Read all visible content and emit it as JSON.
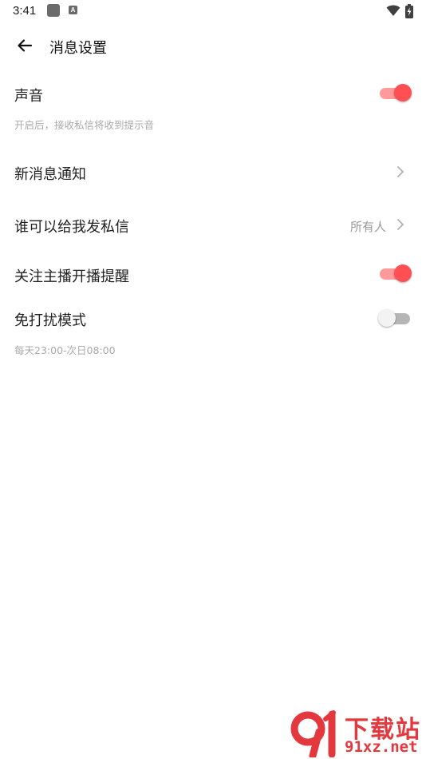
{
  "status_bar": {
    "time": "3:41",
    "a_icon": "A"
  },
  "header": {
    "title": "消息设置"
  },
  "settings": {
    "sound": {
      "label": "声音",
      "desc": "开启后，接收私信将收到提示音",
      "on": true
    },
    "new_msg": {
      "label": "新消息通知"
    },
    "dm": {
      "label": "谁可以给我发私信",
      "value": "所有人"
    },
    "live": {
      "label": "关注主播开播提醒",
      "on": true
    },
    "dnd": {
      "label": "免打扰模式",
      "desc": "每天23:00-次日08:00",
      "on": false
    }
  },
  "watermark": {
    "top_text": "下载站",
    "bottom_text": "91xz.net"
  },
  "colors": {
    "accent": "#ff4f52",
    "accent_track": "#ff9a9a",
    "off_track": "#b6b6b6",
    "watermark": "#e3383d"
  },
  "icons": [
    "back-arrow-icon",
    "chevron-right-icon",
    "wifi-icon",
    "battery-icon"
  ]
}
